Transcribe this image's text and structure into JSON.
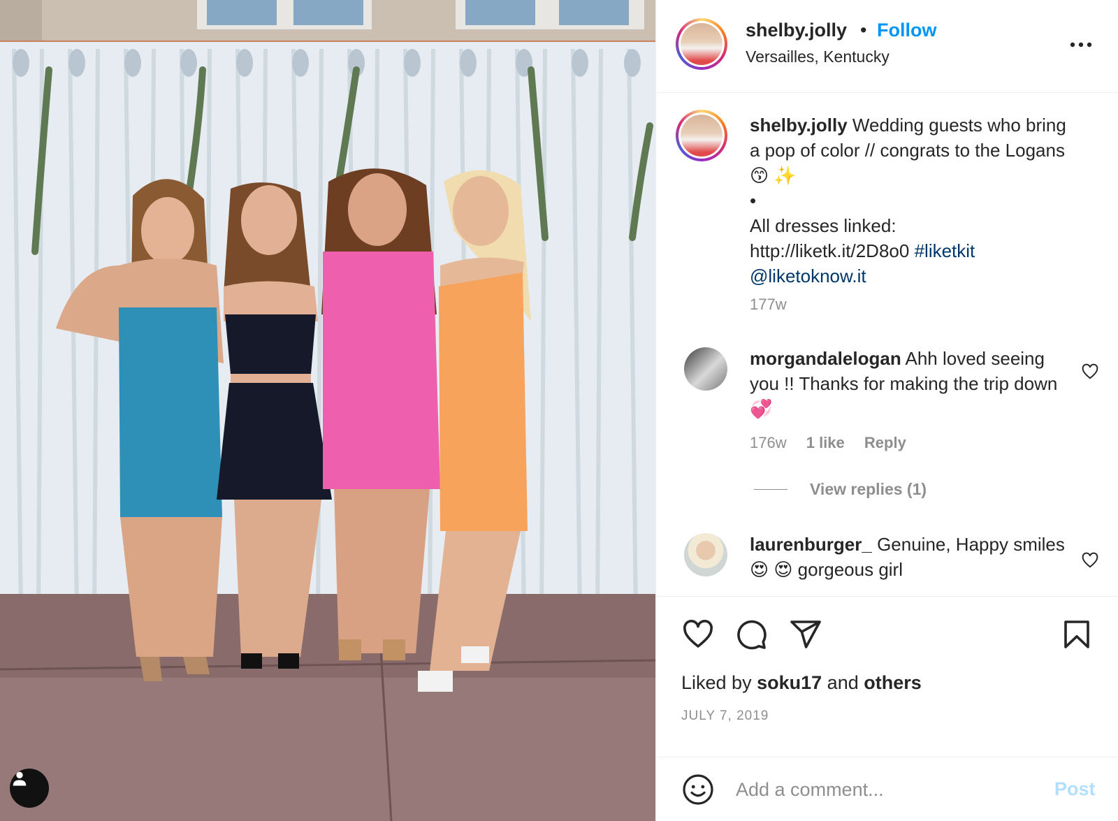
{
  "post": {
    "username": "shelby.jolly",
    "separator": "•",
    "follow_label": "Follow",
    "location": "Versailles, Kentucky",
    "more_icon": "more-horizontal-icon"
  },
  "caption": {
    "username": "shelby.jolly",
    "text_line1": "Wedding guests who bring a pop of color // congrats to the Logans",
    "emojis": "😙 ✨",
    "bullet": "•",
    "text_line2": "All dresses linked:",
    "url": "http://liketk.it/2D8o0",
    "hashtag": "#liketkit",
    "mention": "@liketoknow.it",
    "age": "177w"
  },
  "comments": [
    {
      "username": "morgandalelogan",
      "text": "Ahh loved seeing you !! Thanks for making the trip down",
      "emoji": "💞",
      "age": "176w",
      "likes": "1 like",
      "reply_label": "Reply",
      "view_replies": "View replies (1)"
    },
    {
      "username": "laurenburger_",
      "text_a": "Genuine, Happy smiles",
      "emoji": "😍 😍",
      "text_b": "gorgeous girl"
    }
  ],
  "actions": {
    "liked_prefix": "Liked by",
    "liked_user": "soku17",
    "liked_and": "and",
    "liked_others": "others",
    "date": "JULY 7, 2019"
  },
  "add_comment": {
    "placeholder": "Add a comment...",
    "post_label": "Post"
  },
  "colors": {
    "follow": "#0095f6",
    "post_disabled": "#b2dffc",
    "link": "#00376b",
    "muted": "#8e8e8e"
  }
}
